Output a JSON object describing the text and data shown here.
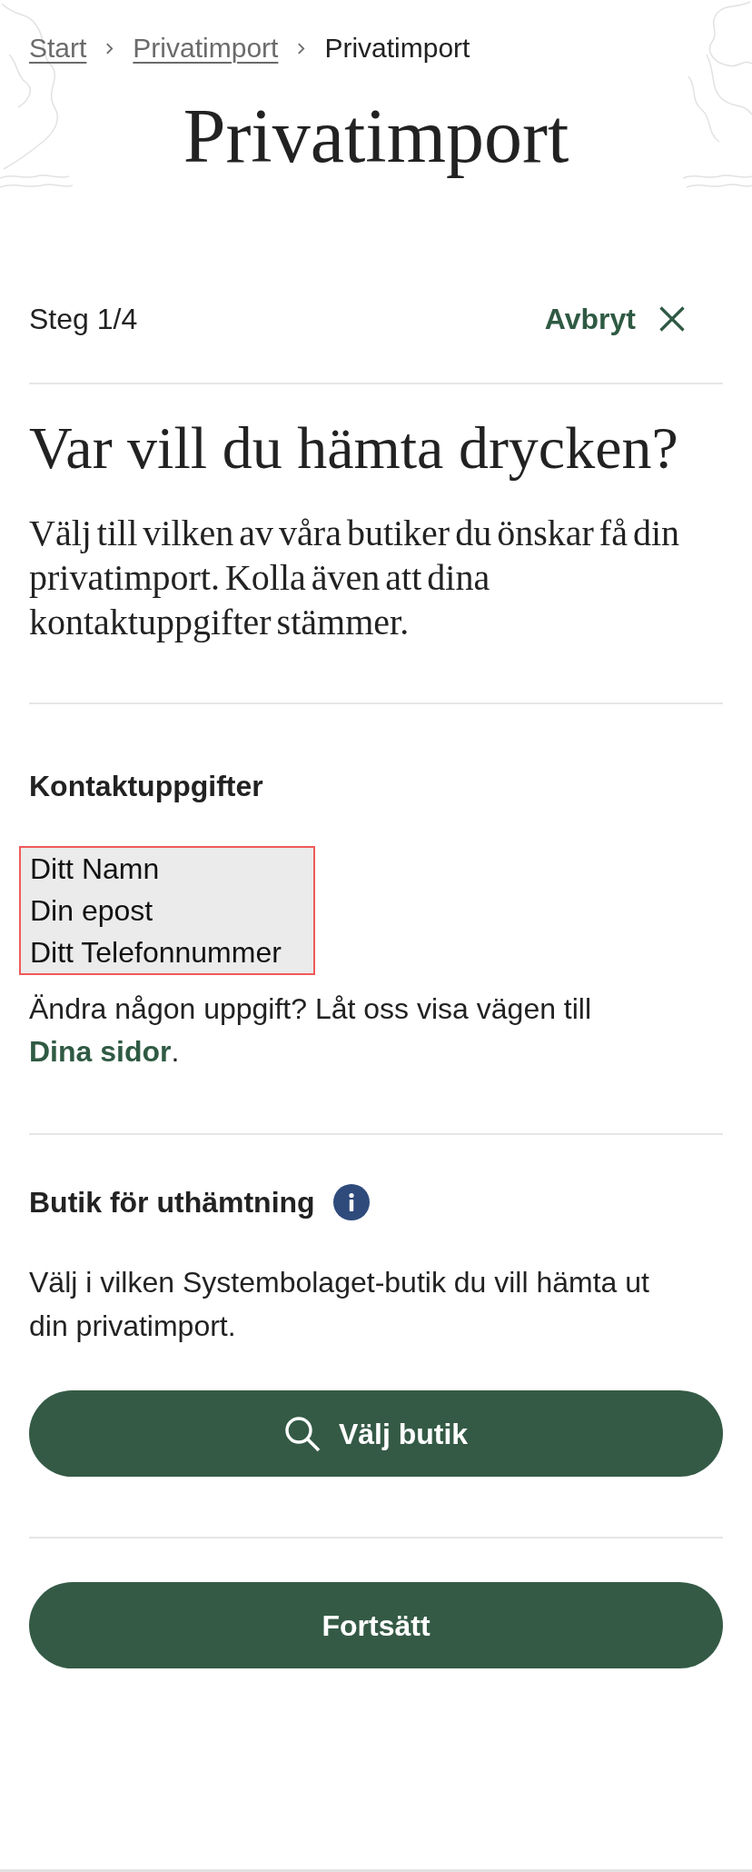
{
  "breadcrumbs": [
    {
      "label": "Start",
      "current": false
    },
    {
      "label": "Privatimport",
      "current": false
    },
    {
      "label": "Privatimport",
      "current": true
    }
  ],
  "title": "Privatimport",
  "step": {
    "label": "Steg 1/4",
    "cancel": "Avbryt"
  },
  "heading": "Var vill du hämta drycken?",
  "intro": "Välj till vilken av våra butiker du önskar få din privatimport. Kolla även att dina kontaktuppgifter stämmer.",
  "contact": {
    "title": "Kontaktuppgifter",
    "details": [
      "Ditt Namn",
      "Din epost",
      "Ditt Telefonnummer"
    ],
    "note": "Ändra någon uppgift? Låt oss visa vägen till",
    "link": "Dina sidor",
    "note_end": "."
  },
  "store": {
    "title": "Butik för uthämtning",
    "text": "Välj i vilken Systembolaget-butik du vill hämta ut din privatimport.",
    "button": "Välj butik"
  },
  "continue_button": "Fortsätt"
}
